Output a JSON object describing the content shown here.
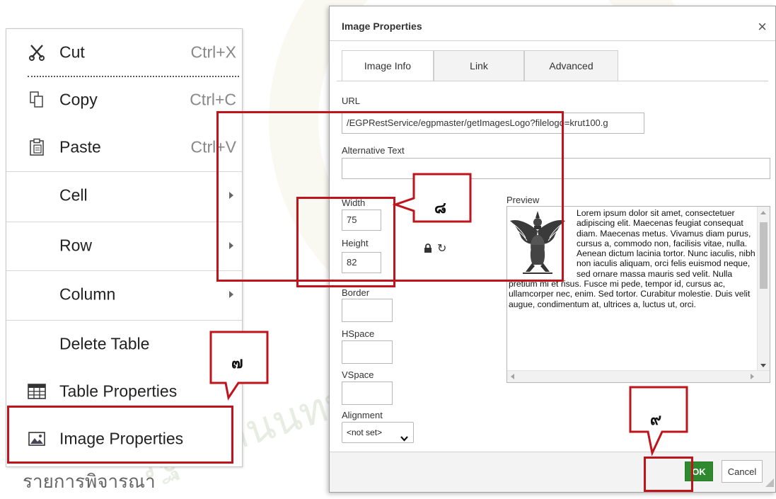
{
  "context_menu": {
    "items": [
      {
        "label": "Cut",
        "shortcut": "Ctrl+X",
        "icon": "scissors-icon"
      },
      {
        "label": "Copy",
        "shortcut": "Ctrl+C",
        "icon": "copy-icon"
      },
      {
        "label": "Paste",
        "shortcut": "Ctrl+V",
        "icon": "clipboard-icon"
      },
      {
        "label": "Cell",
        "shortcut": "",
        "icon": ""
      },
      {
        "label": "Row",
        "shortcut": "",
        "icon": ""
      },
      {
        "label": "Column",
        "shortcut": "",
        "icon": ""
      },
      {
        "label": "Delete Table",
        "shortcut": "",
        "icon": ""
      },
      {
        "label": "Table Properties",
        "shortcut": "",
        "icon": "table-icon"
      },
      {
        "label": "Image Properties",
        "shortcut": "",
        "icon": "image-icon"
      }
    ],
    "below_text": "รายการพิจารณา"
  },
  "dialog": {
    "title": "Image Properties",
    "close_label": "×",
    "tabs": [
      {
        "label": "Image Info",
        "active": true
      },
      {
        "label": "Link",
        "active": false
      },
      {
        "label": "Advanced",
        "active": false
      }
    ],
    "url_label": "URL",
    "url_value": "/EGPRestService/egpmaster/getImagesLogo?filelogo=krut100.g",
    "alt_label": "Alternative Text",
    "alt_value": "",
    "width_label": "Width",
    "width_value": "75",
    "height_label": "Height",
    "height_value": "82",
    "border_label": "Border",
    "hspace_label": "HSpace",
    "vspace_label": "VSpace",
    "alignment_label": "Alignment",
    "alignment_value": "<not set>",
    "preview_label": "Preview",
    "preview_text": "Lorem ipsum dolor sit amet, consectetuer adipiscing elit. Maecenas feugiat consequat diam. Maecenas metus. Vivamus diam purus, cursus a, commodo non, facilisis vitae, nulla. Aenean dictum lacinia tortor. Nunc iaculis, nibh non iaculis aliquam, orci felis euismod neque, sed ornare massa mauris sed velit. Nulla pretium mi et risus. Fusce mi pede, tempor id, cursus ac, ullamcorper nec, enim. Sed tortor. Curabitur molestie. Duis velit augue, condimentum at, ultrices a, luctus ut, orci.",
    "ok_label": "OK",
    "cancel_label": "Cancel"
  },
  "annotations": {
    "step7": "๗",
    "step8": "๘",
    "step9": "๙",
    "color": "#c0141c"
  }
}
